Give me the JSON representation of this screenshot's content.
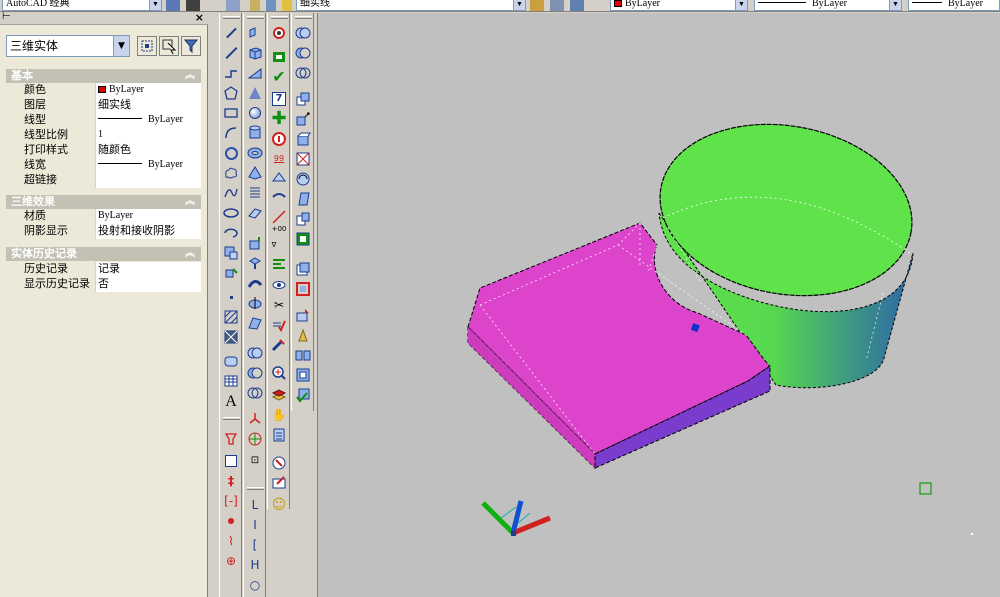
{
  "topbar": {
    "workspace": "AutoCAD 经典",
    "layer": "细实线",
    "color": "ByLayer",
    "linetype": "ByLayer",
    "lineweight": "ByLayer"
  },
  "palette": {
    "object_type": "三维实体",
    "sections": [
      {
        "title": "基本",
        "rows": [
          {
            "key": "颜色",
            "value": "ByLayer"
          },
          {
            "key": "图层",
            "value": "细实线"
          },
          {
            "key": "线型",
            "value": "ByLayer"
          },
          {
            "key": "线型比例",
            "value": "1"
          },
          {
            "key": "打印样式",
            "value": "随颜色"
          },
          {
            "key": "线宽",
            "value": "ByLayer"
          },
          {
            "key": "超链接",
            "value": ""
          }
        ]
      },
      {
        "title": "三维效果",
        "rows": [
          {
            "key": "材质",
            "value": "ByLayer"
          },
          {
            "key": "阴影显示",
            "value": "投射和接收阴影"
          }
        ]
      },
      {
        "title": "实体历史记录",
        "rows": [
          {
            "key": "历史记录",
            "value": "记录"
          },
          {
            "key": "显示历史记录",
            "value": "否"
          }
        ]
      }
    ]
  },
  "toolbars": {
    "draw_text_icon": "A",
    "dim_letters": [
      "L",
      "I",
      "[",
      "H",
      "○"
    ],
    "number_icon": "7",
    "fraction_icon": "99"
  },
  "viewport": {
    "background": "#c0c0c0",
    "box_top_color": "#dd44cc",
    "box_side_color": "#7a3ccc",
    "cylinder_top_color": "#5fe24a",
    "cylinder_side_shade": "#2e66a8",
    "grip_color": "#1030d0"
  }
}
